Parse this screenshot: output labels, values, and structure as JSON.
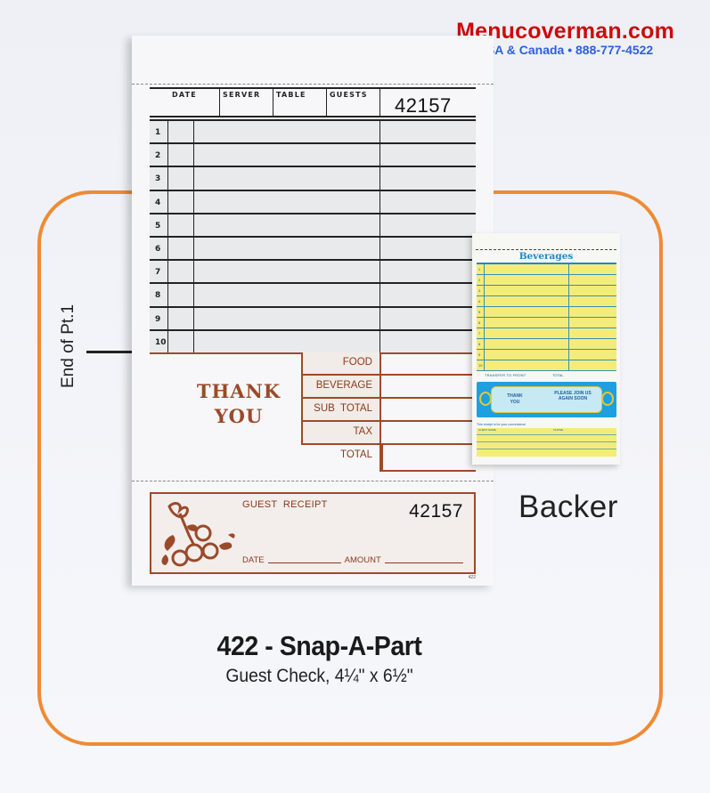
{
  "brand": {
    "site": "Menucoverman.com",
    "contact": "USA & Canada • 888-777-4522",
    "colors": {
      "site": "#cc0a0a",
      "contact": "#2d5fe0",
      "frame": "#ef8a35"
    }
  },
  "guest_check": {
    "header": {
      "columns": [
        "DATE",
        "SERVER",
        "TABLE",
        "GUESTS"
      ],
      "check_number": "42157"
    },
    "lines": [
      "1",
      "2",
      "3",
      "4",
      "5",
      "6",
      "7",
      "8",
      "9",
      "10"
    ],
    "thank_you": [
      "THANK",
      "YOU"
    ],
    "totals": [
      "FOOD",
      "BEVERAGE",
      "SUB  TOTAL",
      "TAX",
      "TOTAL"
    ],
    "receipt": {
      "title": "GUEST  RECEIPT",
      "check_number": "42157",
      "date_label": "DATE",
      "amount_label": "AMOUNT",
      "form_number": "422"
    },
    "accent_color": "#a0492a"
  },
  "end_marker": "End of Pt.1",
  "backer": {
    "title": "Beverages",
    "lines": [
      "1",
      "2",
      "3",
      "4",
      "5",
      "6",
      "7",
      "8",
      "9",
      "10"
    ],
    "transfer_label": "TRANSFER TO FRONT",
    "total_label": "TOTAL",
    "banner_left": "THANK YOU",
    "banner_right": "PLEASE JOIN US AGAIN SOON",
    "receipt_note": "This receipt is for your convenience",
    "bottom_left": "GUEST NAME",
    "bottom_right": "PHONE",
    "label": "Backer"
  },
  "caption": {
    "title": "422 - Snap-A-Part",
    "subtitle": "Guest Check, 4¼\" x 6½\""
  }
}
